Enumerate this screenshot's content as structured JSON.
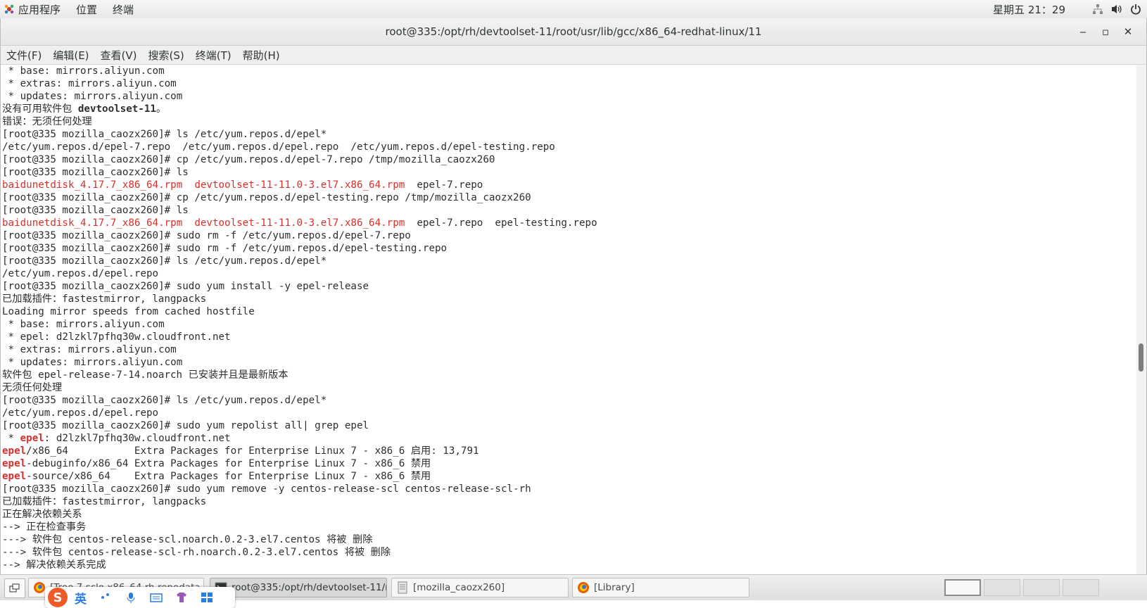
{
  "top_panel": {
    "applications": "应用程序",
    "places": "位置",
    "terminal": "终端",
    "clock": "星期五 21：29",
    "icons": [
      "network-icon",
      "volume-icon",
      "power-icon"
    ]
  },
  "window": {
    "title": "root@335:/opt/rh/devtoolset-11/root/usr/lib/gcc/x86_64-redhat-linux/11",
    "controls": {
      "minimize": "‒",
      "maximize": "▫",
      "close": "✕"
    }
  },
  "menu": {
    "items": [
      "文件(F)",
      "编辑(E)",
      "查看(V)",
      "搜索(S)",
      "终端(T)",
      "帮助(H)"
    ]
  },
  "terminal": {
    "lines": [
      [
        {
          "t": " * base: mirrors.aliyun.com"
        }
      ],
      [
        {
          "t": " * extras: mirrors.aliyun.com"
        }
      ],
      [
        {
          "t": " * updates: mirrors.aliyun.com"
        }
      ],
      [
        {
          "t": "没有可用软件包 "
        },
        {
          "t": "devtoolset-11",
          "s": "bold"
        },
        {
          "t": "。"
        }
      ],
      [
        {
          "t": "错误：无须任何处理"
        }
      ],
      [
        {
          "t": "[root@335 mozilla_caozx260]# ls /etc/yum.repos.d/epel*"
        }
      ],
      [
        {
          "t": "/etc/yum.repos.d/epel-7.repo  /etc/yum.repos.d/epel.repo  /etc/yum.repos.d/epel-testing.repo"
        }
      ],
      [
        {
          "t": "[root@335 mozilla_caozx260]# cp /etc/yum.repos.d/epel-7.repo /tmp/mozilla_caozx260"
        }
      ],
      [
        {
          "t": "[root@335 mozilla_caozx260]# ls"
        }
      ],
      [
        {
          "t": "baidunetdisk_4.17.7_x86_64.rpm",
          "s": "red"
        },
        {
          "t": "  "
        },
        {
          "t": "devtoolset-11-11.0-3.el7.x86_64.rpm",
          "s": "red"
        },
        {
          "t": "  epel-7.repo"
        }
      ],
      [
        {
          "t": "[root@335 mozilla_caozx260]# cp /etc/yum.repos.d/epel-testing.repo /tmp/mozilla_caozx260"
        }
      ],
      [
        {
          "t": "[root@335 mozilla_caozx260]# ls"
        }
      ],
      [
        {
          "t": "baidunetdisk_4.17.7_x86_64.rpm",
          "s": "red"
        },
        {
          "t": "  "
        },
        {
          "t": "devtoolset-11-11.0-3.el7.x86_64.rpm",
          "s": "red"
        },
        {
          "t": "  epel-7.repo  epel-testing.repo"
        }
      ],
      [
        {
          "t": "[root@335 mozilla_caozx260]# sudo rm -f /etc/yum.repos.d/epel-7.repo"
        }
      ],
      [
        {
          "t": "[root@335 mozilla_caozx260]# sudo rm -f /etc/yum.repos.d/epel-testing.repo"
        }
      ],
      [
        {
          "t": "[root@335 mozilla_caozx260]# ls /etc/yum.repos.d/epel*"
        }
      ],
      [
        {
          "t": "/etc/yum.repos.d/epel.repo"
        }
      ],
      [
        {
          "t": "[root@335 mozilla_caozx260]# sudo yum install -y epel-release"
        }
      ],
      [
        {
          "t": "已加载插件：fastestmirror, langpacks"
        }
      ],
      [
        {
          "t": "Loading mirror speeds from cached hostfile"
        }
      ],
      [
        {
          "t": " * base: mirrors.aliyun.com"
        }
      ],
      [
        {
          "t": " * epel: d2lzkl7pfhq30w.cloudfront.net"
        }
      ],
      [
        {
          "t": " * extras: mirrors.aliyun.com"
        }
      ],
      [
        {
          "t": " * updates: mirrors.aliyun.com"
        }
      ],
      [
        {
          "t": "软件包 epel-release-7-14.noarch 已安装并且是最新版本"
        }
      ],
      [
        {
          "t": "无须任何处理"
        }
      ],
      [
        {
          "t": "[root@335 mozilla_caozx260]# ls /etc/yum.repos.d/epel*"
        }
      ],
      [
        {
          "t": "/etc/yum.repos.d/epel.repo"
        }
      ],
      [
        {
          "t": "[root@335 mozilla_caozx260]# sudo yum repolist all| grep epel"
        }
      ],
      [
        {
          "t": " * "
        },
        {
          "t": "epel",
          "s": "redb"
        },
        {
          "t": ": d2lzkl7pfhq30w.cloudfront.net"
        }
      ],
      [
        {
          "t": "epel",
          "s": "redb"
        },
        {
          "t": "/x86_64           Extra Packages for Enterprise Linux 7 - x86_6 启用: 13,791"
        }
      ],
      [
        {
          "t": "epel",
          "s": "redb"
        },
        {
          "t": "-debuginfo/x86_64 Extra Packages for Enterprise Linux 7 - x86_6 禁用"
        }
      ],
      [
        {
          "t": "epel",
          "s": "redb"
        },
        {
          "t": "-source/x86_64    Extra Packages for Enterprise Linux 7 - x86_6 禁用"
        }
      ],
      [
        {
          "t": "[root@335 mozilla_caozx260]# sudo yum remove -y centos-release-scl centos-release-scl-rh"
        }
      ],
      [
        {
          "t": "已加载插件：fastestmirror, langpacks"
        }
      ],
      [
        {
          "t": "正在解决依赖关系"
        }
      ],
      [
        {
          "t": "--> 正在检查事务"
        }
      ],
      [
        {
          "t": "---> 软件包 centos-release-scl.noarch.0.2-3.el7.centos 将被 删除"
        }
      ],
      [
        {
          "t": "---> 软件包 centos-release-scl-rh.noarch.0.2-3.el7.centos 将被 删除"
        }
      ],
      [
        {
          "t": "--> 解决依赖关系完成"
        }
      ]
    ],
    "scroll_position": 0.58
  },
  "taskbar": {
    "tasks": [
      {
        "label": "[Tree 7 sclo x86_64 rh repodata",
        "icon": "firefox-icon",
        "active": false
      },
      {
        "label": "root@335:/opt/rh/devtoolset-11/r...",
        "icon": "terminal-icon",
        "active": true
      },
      {
        "label": "[mozilla_caozx260]",
        "icon": "file-manager-icon",
        "active": false
      },
      {
        "label": "[Library]",
        "icon": "firefox-icon",
        "active": false
      }
    ],
    "workspaces": 4,
    "active_workspace": 1
  },
  "ime": {
    "logo": "S",
    "mode": "英"
  }
}
